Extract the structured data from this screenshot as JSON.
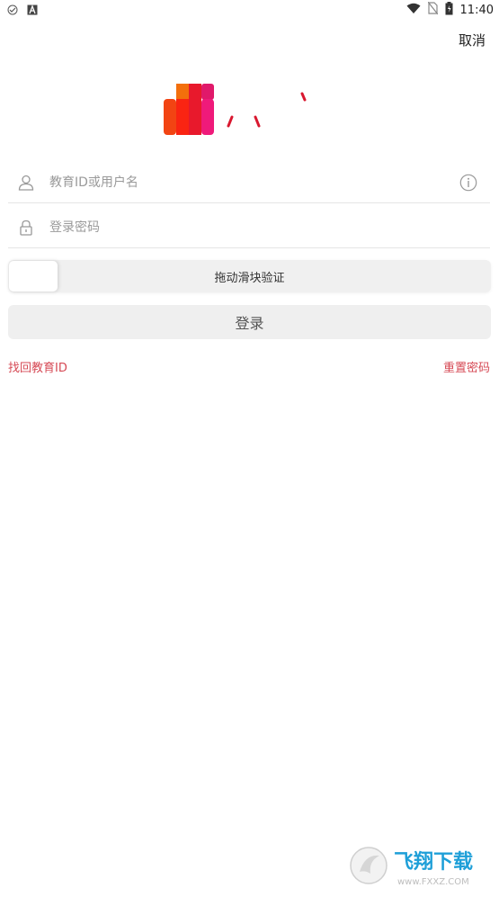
{
  "status_bar": {
    "time": "11:40"
  },
  "header": {
    "cancel_label": "取消"
  },
  "form": {
    "username_placeholder": "教育ID或用户名",
    "password_placeholder": "登录密码",
    "slider_label": "拖动滑块验证",
    "login_label": "登录"
  },
  "links": {
    "recover_id": "找回教育ID",
    "reset_password": "重置密码"
  },
  "watermark": {
    "brand_text": "飞翔下载",
    "url_text": "www.FXXZ.COM"
  },
  "colors": {
    "link_red": "#d64a55",
    "logo_orange": "#f36f0c",
    "logo_red": "#e8192c",
    "logo_pink": "#ef1a7a"
  },
  "icons": {
    "user": "user-icon",
    "lock": "lock-icon",
    "info": "info-icon"
  }
}
